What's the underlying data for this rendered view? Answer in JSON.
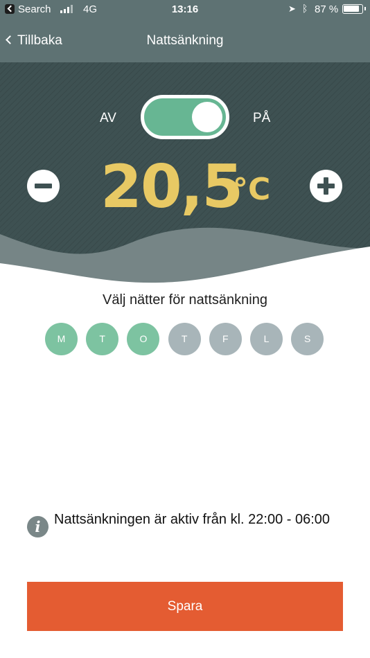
{
  "status_bar": {
    "carrier": "Search",
    "network": "4G",
    "time": "13:16",
    "battery_percent": "87 %",
    "battery_level": 0.87
  },
  "nav": {
    "back_label": "Tillbaka",
    "title": "Nattsänkning"
  },
  "toggle": {
    "off_label": "AV",
    "on_label": "PÅ",
    "state": "on",
    "color_on": "#67b693"
  },
  "temperature": {
    "value": "20,5",
    "unit": "°C",
    "color": "#e8c964"
  },
  "days": {
    "title": "Välj nätter för nattsänkning",
    "active_color": "#7dc3a1",
    "inactive_color": "#a8b5b9",
    "items": [
      {
        "label": "M",
        "selected": true
      },
      {
        "label": "T",
        "selected": true
      },
      {
        "label": "O",
        "selected": true
      },
      {
        "label": "T",
        "selected": false
      },
      {
        "label": "F",
        "selected": false
      },
      {
        "label": "L",
        "selected": false
      },
      {
        "label": "S",
        "selected": false
      }
    ]
  },
  "info": {
    "icon": "info-icon",
    "icon_glyph": "i",
    "text": "Nattsänkningen är aktiv från kl. 22:00 - 06:00"
  },
  "save": {
    "label": "Spara",
    "color": "#e45c32"
  }
}
